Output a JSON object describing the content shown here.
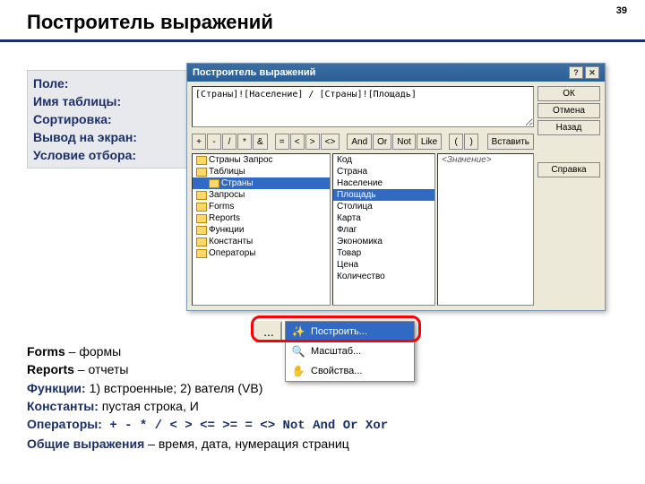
{
  "pageNum": "39",
  "title": "Построитель выражений",
  "grid": {
    "f1": "Поле:",
    "f2": "Имя таблицы:",
    "f3": "Сортировка:",
    "f4": "Вывод на экран:",
    "f5": "Условие отбора:"
  },
  "win": {
    "title": "Построитель выражений",
    "expr": "[Страны]![Население] / [Страны]![Площадь]",
    "btnOk": "ОК",
    "btnCancel": "Отмена",
    "btnBack": "Назад",
    "btnHelp": "Справка",
    "paste": "Вставить",
    "ops": [
      "+",
      "-",
      "/",
      "*",
      "&",
      "=",
      "<",
      ">",
      "<>",
      "And",
      "Or",
      "Not",
      "Like",
      "(",
      ")"
    ]
  },
  "tree": [
    {
      "ind": 0,
      "label": "Страны Запрос",
      "sel": false
    },
    {
      "ind": 0,
      "label": "Таблицы",
      "sel": false
    },
    {
      "ind": 1,
      "label": "Страны",
      "sel": true
    },
    {
      "ind": 0,
      "label": "Запросы",
      "sel": false
    },
    {
      "ind": 0,
      "label": "Forms",
      "sel": false
    },
    {
      "ind": 0,
      "label": "Reports",
      "sel": false
    },
    {
      "ind": 0,
      "label": "Функции",
      "sel": false
    },
    {
      "ind": 0,
      "label": "Константы",
      "sel": false
    },
    {
      "ind": 0,
      "label": "Операторы",
      "sel": false
    }
  ],
  "fields": [
    {
      "label": "Код",
      "sel": false
    },
    {
      "label": "Страна",
      "sel": false
    },
    {
      "label": "Население",
      "sel": false
    },
    {
      "label": "Площадь",
      "sel": true
    },
    {
      "label": "Столица",
      "sel": false
    },
    {
      "label": "Карта",
      "sel": false
    },
    {
      "label": "Флаг",
      "sel": false
    },
    {
      "label": "Экономика",
      "sel": false
    },
    {
      "label": "Товар",
      "sel": false
    },
    {
      "label": "Цена",
      "sel": false
    },
    {
      "label": "Количество",
      "sel": false
    }
  ],
  "pane3": "<Значение>",
  "menuDots": "...",
  "ctx": {
    "i1": "Построить...",
    "i2": "Масштаб...",
    "i3": "Свойства..."
  },
  "notes": {
    "l1a": "Forms",
    "l1b": " – формы",
    "l2a": "Reports",
    "l2b": " – отчеты",
    "l3a": "Функции:",
    "l3b": " 1) встроенные; 2)                              вателя (VB)",
    "l4a": "Константы:",
    "l4b": " пустая строка, И",
    "l5a": "Операторы:",
    "l5ops": "  +  -  *  /  <  >  <=  >=  =  <>   Not And Or Xor",
    "l6a": "Общие выражения",
    "l6b": " – время, дата, нумерация страниц"
  }
}
